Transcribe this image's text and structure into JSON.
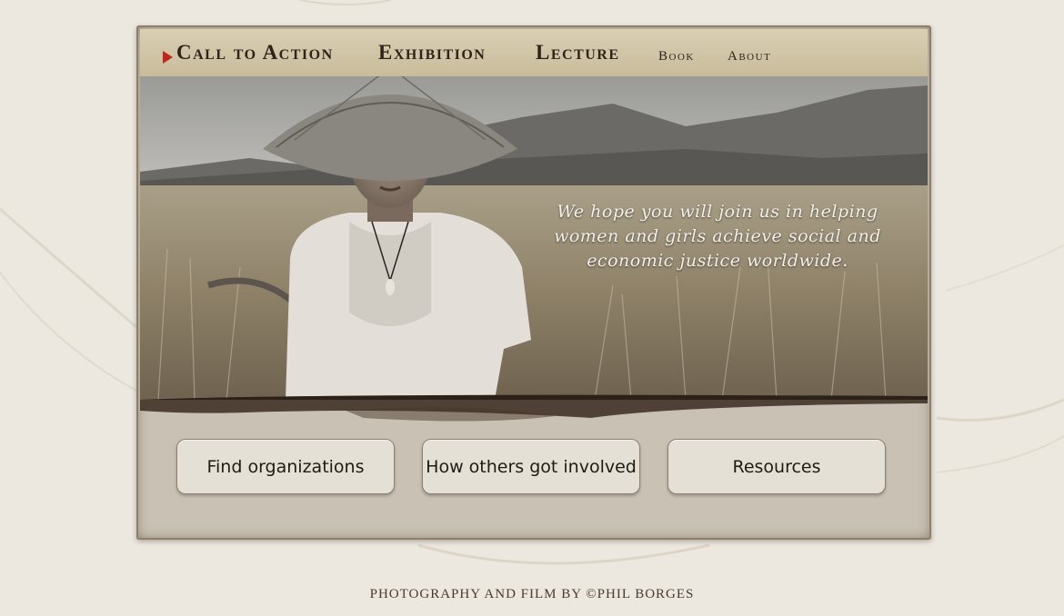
{
  "nav": {
    "items": [
      {
        "label": "Call to Action",
        "active": true
      },
      {
        "label": "Exhibition"
      },
      {
        "label": "Lecture"
      },
      {
        "label": "Book"
      },
      {
        "label": "About"
      }
    ]
  },
  "hero": {
    "quote_line1": "We hope you will join us in helping",
    "quote_line2": "women and girls achieve social and",
    "quote_line3": "economic justice worldwide."
  },
  "buttons": {
    "find_orgs": "Find organizations",
    "how_others": "How others got involved",
    "resources": "Resources"
  },
  "footer": {
    "credit": "PHOTOGRAPHY AND FILM BY ©PHIL BORGES"
  },
  "colors": {
    "accent_arrow": "#c0271c",
    "nav_bg": "#d4c9aa",
    "page_bg": "#ece8e0"
  }
}
